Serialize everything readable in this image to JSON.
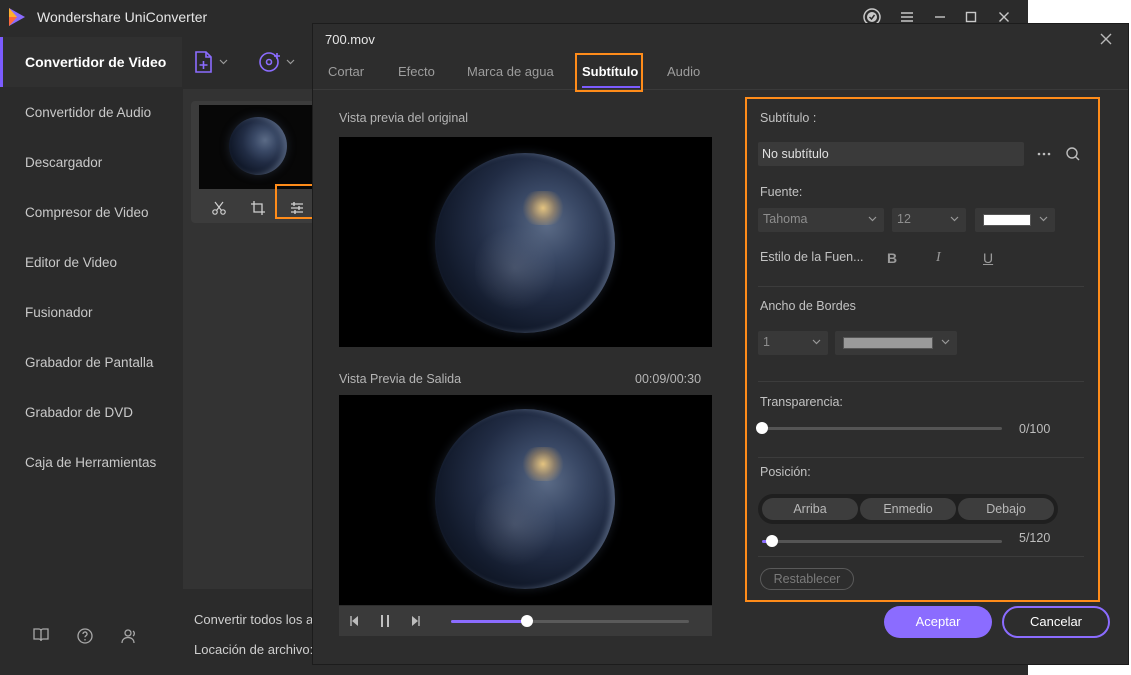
{
  "app": {
    "title": "Wondershare UniConverter",
    "accent_color": "#8b6cff",
    "highlight_color": "#ff8c1a"
  },
  "sidebar": {
    "items": [
      {
        "label": "Convertidor de Video",
        "active": true
      },
      {
        "label": "Convertidor de Audio"
      },
      {
        "label": "Descargador"
      },
      {
        "label": "Compresor de Video"
      },
      {
        "label": "Editor de Video"
      },
      {
        "label": "Fusionador"
      },
      {
        "label": "Grabador de Pantalla"
      },
      {
        "label": "Grabador de DVD"
      },
      {
        "label": "Caja de Herramientas"
      }
    ],
    "bottom_icons": [
      "book-icon",
      "help-icon",
      "account-icon"
    ]
  },
  "workspace": {
    "footer": {
      "convert_all_label": "Convertir todos los ar",
      "location_label": "Locación de archivo:"
    }
  },
  "dialog": {
    "title": "700.mov",
    "tabs": [
      "Cortar",
      "Efecto",
      "Marca de agua",
      "Subtítulo",
      "Audio"
    ],
    "active_tab": "Subtítulo",
    "original_preview_label": "Vista previa del original",
    "output_preview_label": "Vista Previa de Salida",
    "time": "00:09/00:30",
    "playback_progress": 0.32,
    "subtitle": {
      "label": "Subtítulo :",
      "value": "No subtítulo"
    },
    "font": {
      "label": "Fuente:",
      "family": "Tahoma",
      "size": "12",
      "color": "#ffffff",
      "style_label": "Estilo de la Fuen...",
      "bold": "B",
      "italic": "I",
      "underline": "U"
    },
    "border": {
      "label": "Ancho de Bordes",
      "width": "1",
      "color": "#9a9a9a"
    },
    "transparency": {
      "label": "Transparencia:",
      "value_text": "0/100",
      "value": 0
    },
    "position": {
      "label": "Posición:",
      "options": [
        "Arriba",
        "Enmedio",
        "Debajo"
      ],
      "value_text": "5/120",
      "value": 5
    },
    "reset_label": "Restablecer",
    "ok_label": "Aceptar",
    "cancel_label": "Cancelar"
  }
}
